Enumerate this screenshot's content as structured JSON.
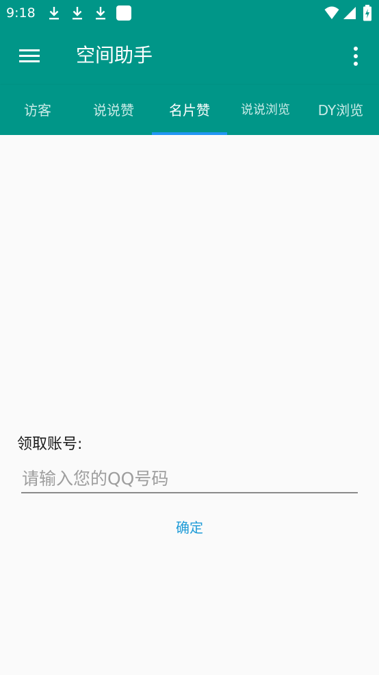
{
  "status_bar": {
    "time": "9:18",
    "icons": [
      "download-icon",
      "download-icon",
      "download-icon",
      "notification-square-icon",
      "wifi-icon",
      "cell-signal-icon",
      "battery-icon"
    ]
  },
  "app_bar": {
    "title": "空间助手",
    "menu_icon": "hamburger-menu-icon",
    "overflow_icon": "more-vert-icon"
  },
  "tabs": [
    {
      "label": "访客",
      "active": false
    },
    {
      "label": "说说赞",
      "active": false
    },
    {
      "label": "名片赞",
      "active": true
    },
    {
      "label": "说说浏览",
      "active": false
    },
    {
      "label": "DY浏览",
      "active": false
    }
  ],
  "form": {
    "label": "领取账号:",
    "input_value": "",
    "input_placeholder": "请输入您的QQ号码",
    "confirm_label": "确定"
  },
  "colors": {
    "primary": "#009688",
    "tab_indicator": "#2196f3",
    "accent_text": "#1e9bd7",
    "background": "#fafafa"
  }
}
